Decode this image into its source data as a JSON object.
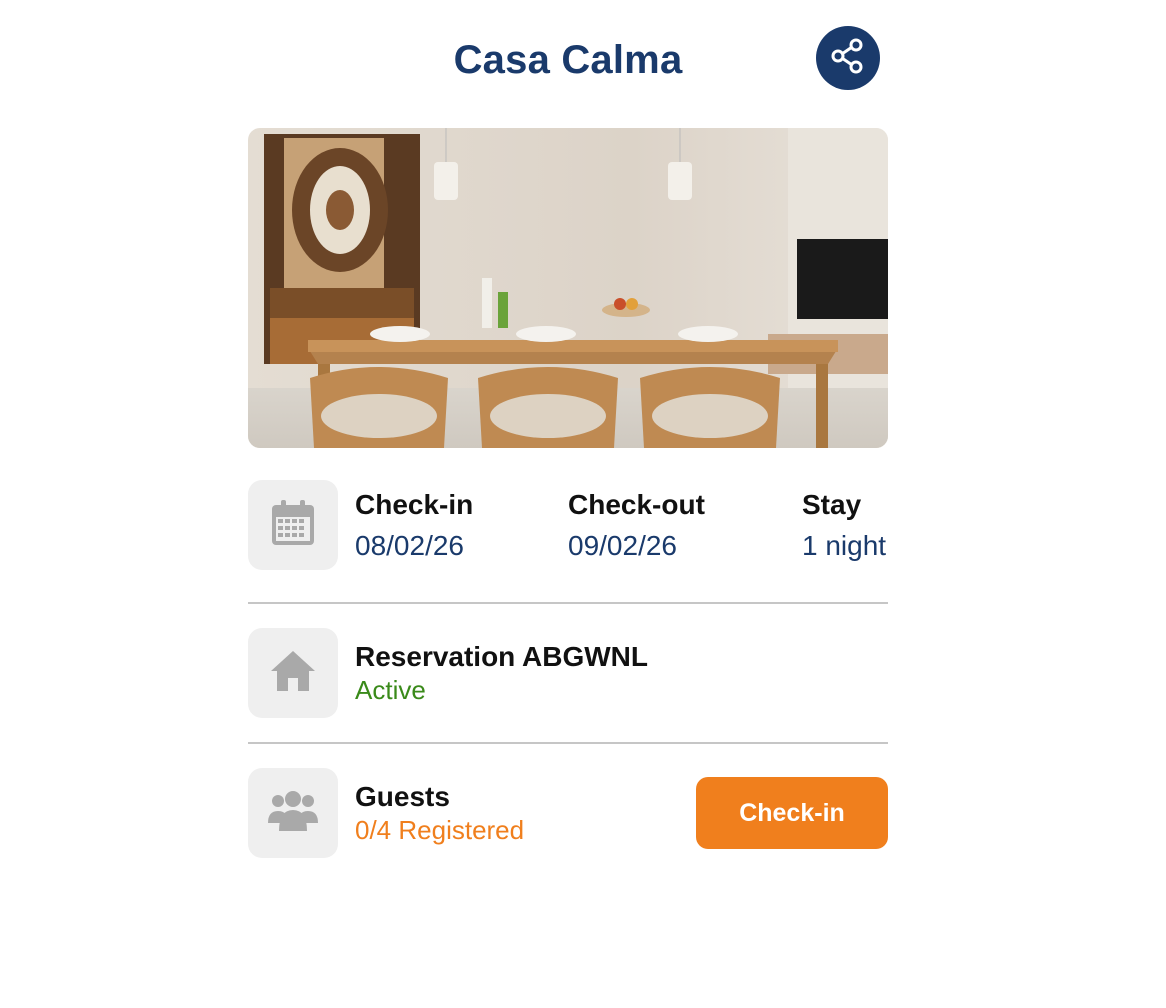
{
  "header": {
    "title": "Casa Calma",
    "share_icon": "share-icon"
  },
  "hero_image": {
    "subject": "dining room with wooden table and chairs"
  },
  "dates": {
    "icon": "calendar-icon",
    "checkin_label": "Check-in",
    "checkin_value": "08/02/26",
    "checkout_label": "Check-out",
    "checkout_value": "09/02/26",
    "stay_label": "Stay",
    "stay_value": "1 night"
  },
  "reservation": {
    "icon": "home-icon",
    "label": "Reservation ABGWNL",
    "status": "Active"
  },
  "guests": {
    "icon": "users-icon",
    "label": "Guests",
    "status": "0/4 Registered",
    "button_label": "Check-in"
  },
  "colors": {
    "primary": "#1a3a6b",
    "accent": "#f07f1d",
    "success": "#3a8a1a",
    "tile_bg": "#efefef"
  }
}
